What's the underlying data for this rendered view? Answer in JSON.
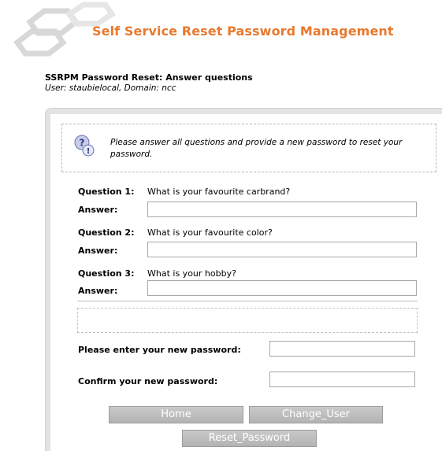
{
  "header": {
    "app_title": "Self Service Reset Password Management",
    "page_heading": "SSRPM Password Reset: Answer questions",
    "user_line": "User: staubielocal, Domain: ncc"
  },
  "info": {
    "icon": "help-icon",
    "message": "Please answer all questions and provide a new password to reset your password."
  },
  "questions": [
    {
      "label": "Question 1:",
      "text": "What is your favourite carbrand?",
      "answer_label": "Answer:",
      "answer_value": ""
    },
    {
      "label": "Question 2:",
      "text": "What is your favourite color?",
      "answer_label": "Answer:",
      "answer_value": ""
    },
    {
      "label": "Question 3:",
      "text": "What is your hobby?",
      "answer_label": "Answer:",
      "answer_value": ""
    }
  ],
  "password": {
    "new_label": "Please enter your new password:",
    "new_value": "",
    "confirm_label": "Confirm your new password:",
    "confirm_value": ""
  },
  "buttons": {
    "home": "Home",
    "change_user": "Change_User",
    "reset_password": "Reset_Password"
  },
  "colors": {
    "title": "#e8792d",
    "button": "#b3b3b3"
  }
}
